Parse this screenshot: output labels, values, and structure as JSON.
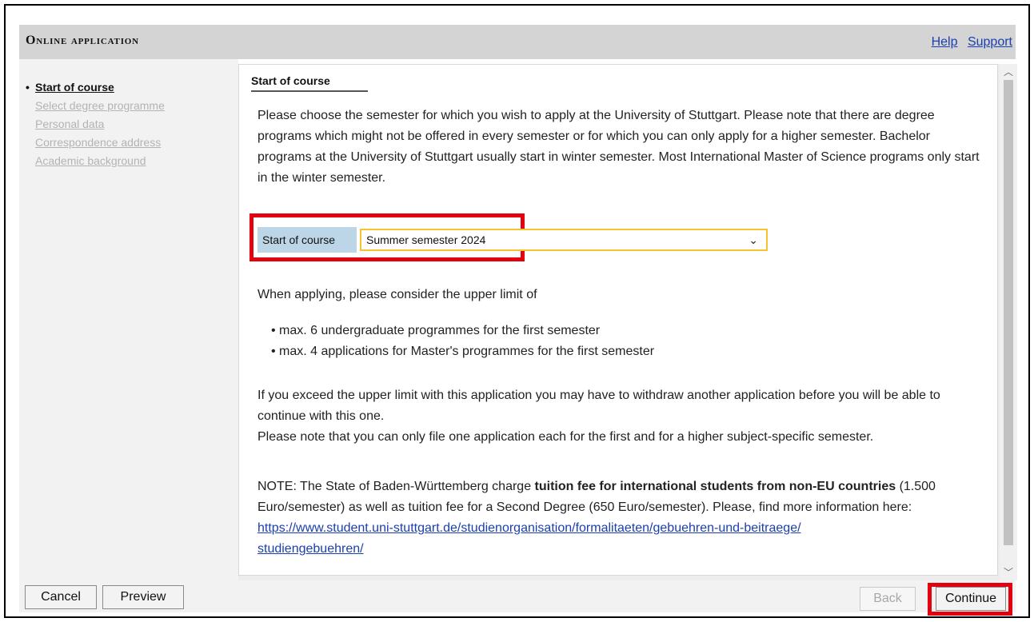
{
  "header": {
    "title": "Online application",
    "links": {
      "help": "Help",
      "support": "Support"
    }
  },
  "sidebar": {
    "items": [
      {
        "label": "Start of course",
        "active": true
      },
      {
        "label": "Select degree programme",
        "active": false
      },
      {
        "label": "Personal data",
        "active": false
      },
      {
        "label": "Correspondence address",
        "active": false
      },
      {
        "label": "Academic background",
        "active": false
      }
    ]
  },
  "main": {
    "section_tab": "Start of course",
    "intro": "Please choose the semester for which you wish to apply at the University of Stuttgart. Please note that there are degree programs which might not be offered in every semester or for which you can only apply for a higher semester. Bachelor programs at the University of Stuttgart usually start in winter semester. Most International Master of Science programs only start in the winter semester.",
    "select": {
      "label": "Start of course",
      "value": "Summer semester 2024"
    },
    "limit_intro": "When applying, please consider the upper limit of",
    "bullets": [
      "max. 6 undergraduate programmes for the first semester",
      "max. 4 applications for Master's programmes for the first semester"
    ],
    "exceed_note": "If you exceed the upper limit with this application you may have to withdraw another application before you will be able to continue with this one.",
    "file_note": "Please note that you can only file one application each for the first and for a higher subject-specific semester.",
    "note_prefix": "NOTE: The State of Baden-Württemberg charge",
    "note_bold": "tuition fee for international students from non-EU countries",
    "note_suffix": "(1.500 Euro/semester) as well as tuition fee for a Second Degree (650 Euro/semester). Please, find more information here:",
    "link": "https://www.student.uni-stuttgart.de/studienorganisation/formalitaeten/gebuehren-und-beitraege/",
    "link_cont": "studiengebuehren/"
  },
  "buttons": {
    "cancel": "Cancel",
    "preview": "Preview",
    "back": "Back",
    "continue": "Continue"
  },
  "colors": {
    "highlight": "#e3000f",
    "select_border": "#f4c430",
    "label_bg": "#bcd6e8",
    "link": "#1a3fb0"
  }
}
